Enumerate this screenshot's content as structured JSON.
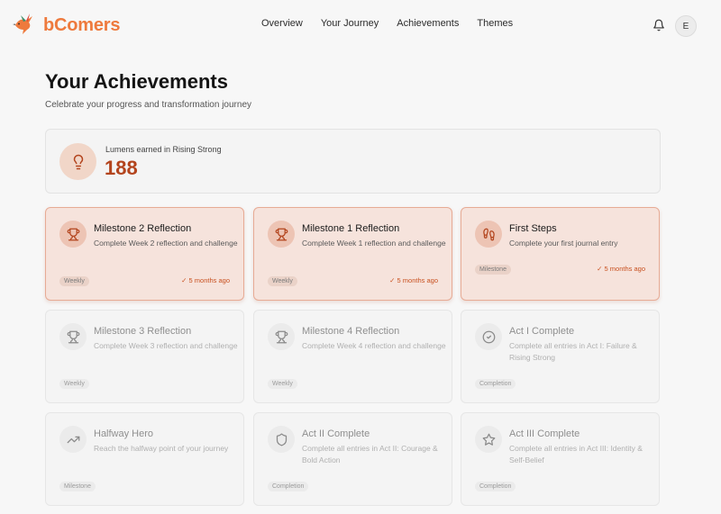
{
  "header": {
    "brand_name": "bComers",
    "nav": [
      "Overview",
      "Your Journey",
      "Achievements",
      "Themes"
    ],
    "avatar_initial": "E"
  },
  "page": {
    "title": "Your Achievements",
    "subtitle": "Celebrate your progress and transformation journey"
  },
  "lumens": {
    "label": "Lumens earned in Rising Strong",
    "value": "188",
    "icon": "lightbulb-icon"
  },
  "colors": {
    "brand": "#ee7a3d",
    "accent": "#b3441d",
    "earned_bg": "#f6e3dc"
  },
  "achievements": [
    {
      "title": "Milestone 2 Reflection",
      "desc": "Complete Week 2 reflection and challenge",
      "tag": "Weekly",
      "date": "✓ 5 months ago",
      "earned": true,
      "icon": "trophy-icon"
    },
    {
      "title": "Milestone 1 Reflection",
      "desc": "Complete Week 1 reflection and challenge",
      "tag": "Weekly",
      "date": "✓ 5 months ago",
      "earned": true,
      "icon": "trophy-icon"
    },
    {
      "title": "First Steps",
      "desc": "Complete your first journal entry",
      "tag": "Milestone",
      "date": "✓ 5 months ago",
      "earned": true,
      "icon": "footprints-icon"
    },
    {
      "title": "Milestone 3 Reflection",
      "desc": "Complete Week 3 reflection and challenge",
      "tag": "Weekly",
      "date": "",
      "earned": false,
      "icon": "trophy-icon"
    },
    {
      "title": "Milestone 4 Reflection",
      "desc": "Complete Week 4 reflection and challenge",
      "tag": "Weekly",
      "date": "",
      "earned": false,
      "icon": "trophy-icon"
    },
    {
      "title": "Act I Complete",
      "desc": "Complete all entries in Act I: Failure & Rising Strong",
      "tag": "Completion",
      "date": "",
      "earned": false,
      "icon": "check-circle-icon"
    },
    {
      "title": "Halfway Hero",
      "desc": "Reach the halfway point of your journey",
      "tag": "Milestone",
      "date": "",
      "earned": false,
      "icon": "trending-up-icon"
    },
    {
      "title": "Act II Complete",
      "desc": "Complete all entries in Act II: Courage & Bold Action",
      "tag": "Completion",
      "date": "",
      "earned": false,
      "icon": "shield-icon"
    },
    {
      "title": "Act III Complete",
      "desc": "Complete all entries in Act III: Identity & Self-Belief",
      "tag": "Completion",
      "date": "",
      "earned": false,
      "icon": "star-icon"
    }
  ]
}
